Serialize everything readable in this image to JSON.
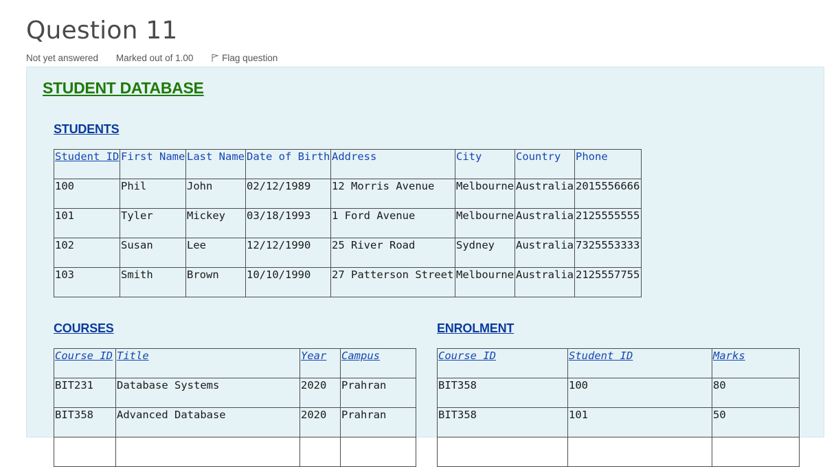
{
  "question": {
    "title": "Question 11",
    "status": "Not yet answered",
    "marked_out": "Marked out of 1.00",
    "flag_label": "Flag question",
    "flag_icon": "flag-outline-icon"
  },
  "database": {
    "title": "STUDENT DATABASE",
    "students": {
      "title": "STUDENTS",
      "headers": [
        "Student ID",
        "First Name",
        "Last Name",
        "Date of Birth",
        "Address",
        "City",
        "Country",
        "Phone"
      ],
      "rows": [
        [
          "100",
          "Phil",
          "John",
          "02/12/1989",
          "12 Morris Avenue",
          "Melbourne",
          "Australia",
          "2015556666"
        ],
        [
          "101",
          "Tyler",
          "Mickey",
          "03/18/1993",
          "1 Ford Avenue",
          "Melbourne",
          "Australia",
          "2125555555"
        ],
        [
          "102",
          "Susan",
          "Lee",
          "12/12/1990",
          "25 River Road",
          "Sydney",
          "Australia",
          "7325553333"
        ],
        [
          "103",
          "Smith",
          "Brown",
          "10/10/1990",
          "27 Patterson Street",
          "Melbourne",
          "Australia",
          "2125557755"
        ]
      ]
    },
    "courses": {
      "title": "COURSES",
      "headers": [
        "Course ID",
        "Title",
        "Year",
        "Campus"
      ],
      "rows": [
        [
          "BIT231",
          "Database Systems",
          "2020",
          "Prahran"
        ],
        [
          "BIT358",
          "Advanced Database",
          "2020",
          "Prahran"
        ],
        [
          "",
          "",
          "",
          ""
        ]
      ]
    },
    "enrolment": {
      "title": "ENROLMENT",
      "headers": [
        "Course ID",
        "Student ID",
        "Marks"
      ],
      "rows": [
        [
          "BIT358",
          "100",
          "80"
        ],
        [
          "BIT358",
          "101",
          "50"
        ],
        [
          "",
          "",
          ""
        ]
      ]
    }
  },
  "colors": {
    "db_title": "#1d7a07",
    "section_title": "#0a3a9e",
    "header_text": "#1646b4",
    "content_bg": "#e6f3f6"
  }
}
